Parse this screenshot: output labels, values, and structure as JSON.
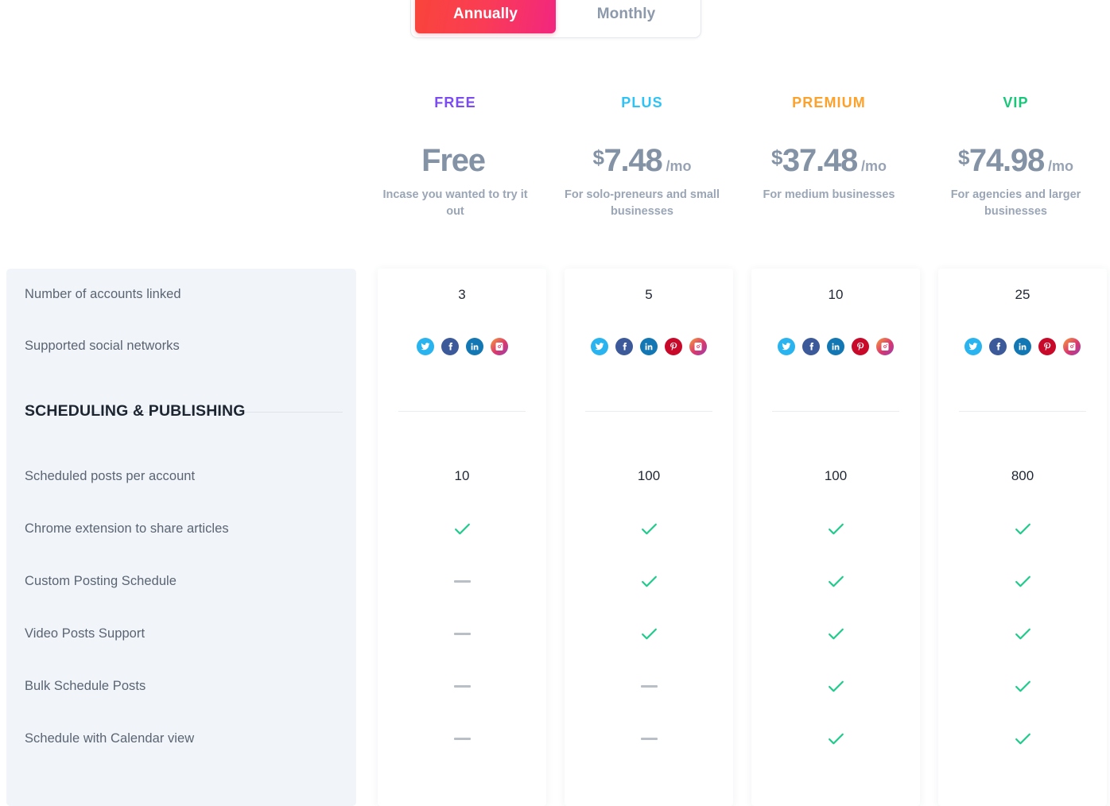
{
  "billing_toggle": {
    "options": [
      {
        "label": "Annually",
        "active": true
      },
      {
        "label": "Monthly",
        "active": false
      }
    ]
  },
  "plans": [
    {
      "name": "FREE",
      "name_color": "#7b4df0",
      "currency": "",
      "amount": "Free",
      "per": "",
      "description": "Incase you wanted to try it out"
    },
    {
      "name": "PLUS",
      "name_color": "#2ec2f5",
      "currency": "$",
      "amount": "7.48",
      "per": "/mo",
      "description": "For solo-preneurs and small businesses"
    },
    {
      "name": "PREMIUM",
      "name_color": "#fca22c",
      "currency": "$",
      "amount": "37.48",
      "per": "/mo",
      "description": "For medium businesses"
    },
    {
      "name": "VIP",
      "name_color": "#19c67a",
      "currency": "$",
      "amount": "74.98",
      "per": "/mo",
      "description": "For agencies and larger businesses"
    }
  ],
  "section_title": "SCHEDULING & PUBLISHING",
  "features": [
    {
      "label": "Number of accounts linked",
      "type": "value",
      "values": [
        "3",
        "5",
        "10",
        "25"
      ]
    },
    {
      "label": "Supported social networks",
      "type": "socials",
      "values": [
        [
          "twitter",
          "facebook",
          "linkedin",
          "instagram"
        ],
        [
          "twitter",
          "facebook",
          "linkedin",
          "pinterest",
          "instagram"
        ],
        [
          "twitter",
          "facebook",
          "linkedin",
          "pinterest",
          "instagram"
        ],
        [
          "twitter",
          "facebook",
          "linkedin",
          "pinterest",
          "instagram"
        ]
      ]
    },
    {
      "label": "Scheduled posts per account",
      "type": "value",
      "values": [
        "10",
        "100",
        "100",
        "800"
      ]
    },
    {
      "label": "Chrome extension to share articles",
      "type": "mark",
      "values": [
        "check",
        "check",
        "check",
        "check"
      ]
    },
    {
      "label": "Custom Posting Schedule",
      "type": "mark",
      "values": [
        "dash",
        "check",
        "check",
        "check"
      ]
    },
    {
      "label": "Video Posts Support",
      "type": "mark",
      "values": [
        "dash",
        "check",
        "check",
        "check"
      ]
    },
    {
      "label": "Bulk Schedule Posts",
      "type": "mark",
      "values": [
        "dash",
        "dash",
        "check",
        "check"
      ]
    },
    {
      "label": "Schedule with Calendar view",
      "type": "mark",
      "values": [
        "dash",
        "dash",
        "check",
        "check"
      ]
    }
  ],
  "colors": {
    "page_background": "#ffffff",
    "panel_background": "#f1f5f9",
    "check_green": "#1ecb8b",
    "dash_gray": "#b9bfc7",
    "price_gray": "#8492a6",
    "toggle_gradient_start": "#f9443a",
    "toggle_gradient_end": "#f2267f"
  }
}
